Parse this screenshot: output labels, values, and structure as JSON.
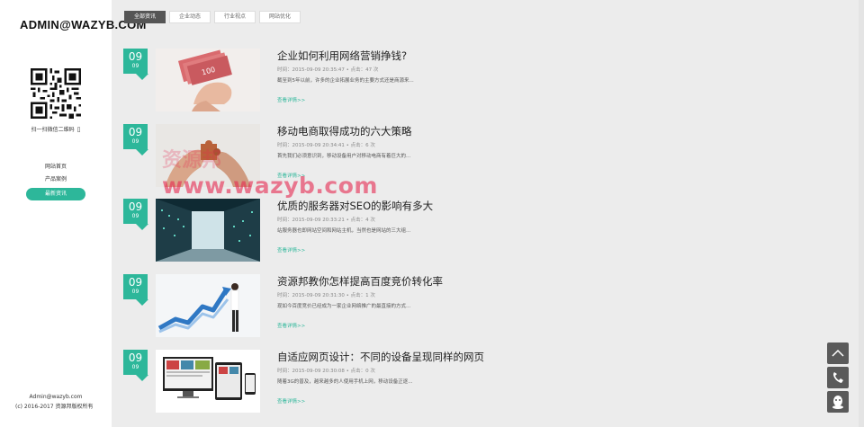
{
  "sidebar": {
    "brand": "ADMIN@WAZYB.COM",
    "qr_caption": "扫一扫微信二维码",
    "nav": [
      {
        "label": "网站首页"
      },
      {
        "label": "产品案例"
      },
      {
        "label": "最新资讯",
        "active": true
      }
    ],
    "footer": {
      "email": "Admin@wazyb.com",
      "copyright": "(c) 2016-2017 资源邦版权所有"
    }
  },
  "tabs": [
    {
      "label": "全部资讯",
      "active": true
    },
    {
      "label": "企业动态"
    },
    {
      "label": "行业视点"
    },
    {
      "label": "网站优化"
    }
  ],
  "accent_color": "#2db79a",
  "articles": [
    {
      "day": "09",
      "month": "09",
      "title": "企业如何利用网络营销挣钱?",
      "meta": "时间：2015-09-09 20:35:47 • 点击：47 次",
      "summary": "截至到5年以前，许多的企业拓展业务的主要方式还是商源来...",
      "more": "查看详情>>",
      "image": "hand-with-money"
    },
    {
      "day": "09",
      "month": "09",
      "title": "移动电商取得成功的六大策略",
      "meta": "时间：2015-09-09 20:34:41 • 点击：6 次",
      "summary": "首先我们必须意识到，移动设备用户对移动电商有着巨大的...",
      "more": "查看详情>>",
      "image": "puzzle-hands"
    },
    {
      "day": "09",
      "month": "09",
      "title": "优质的服务器对SEO的影响有多大",
      "meta": "时间：2015-09-09 20:33:21 • 点击：4 次",
      "summary": "站服务器也即网站空间和网站主机，当然也是网站的三大组...",
      "more": "查看详情>>",
      "image": "server-room"
    },
    {
      "day": "09",
      "month": "09",
      "title": "资源邦教你怎样提高百度竞价转化率",
      "meta": "时间：2015-09-09 20:31:30 • 点击：1 次",
      "summary": "现如今百度竞价已经成为一家企业网络推广的最直接的方式...",
      "more": "查看详情>>",
      "image": "growth-chart"
    },
    {
      "day": "09",
      "month": "09",
      "title": "自适应网页设计：不同的设备呈现同样的网页",
      "meta": "时间：2015-09-09 20:30:08 • 点击：0 次",
      "summary": "随着3G的普及，越来越多的人使用手机上网，移动设备正逐...",
      "more": "查看详情>>",
      "image": "responsive-devices"
    }
  ],
  "watermark": {
    "url": "www.wazyb.com",
    "cn": "资源邦"
  },
  "float_buttons": [
    "back-to-top-icon",
    "phone-icon",
    "qq-icon"
  ]
}
